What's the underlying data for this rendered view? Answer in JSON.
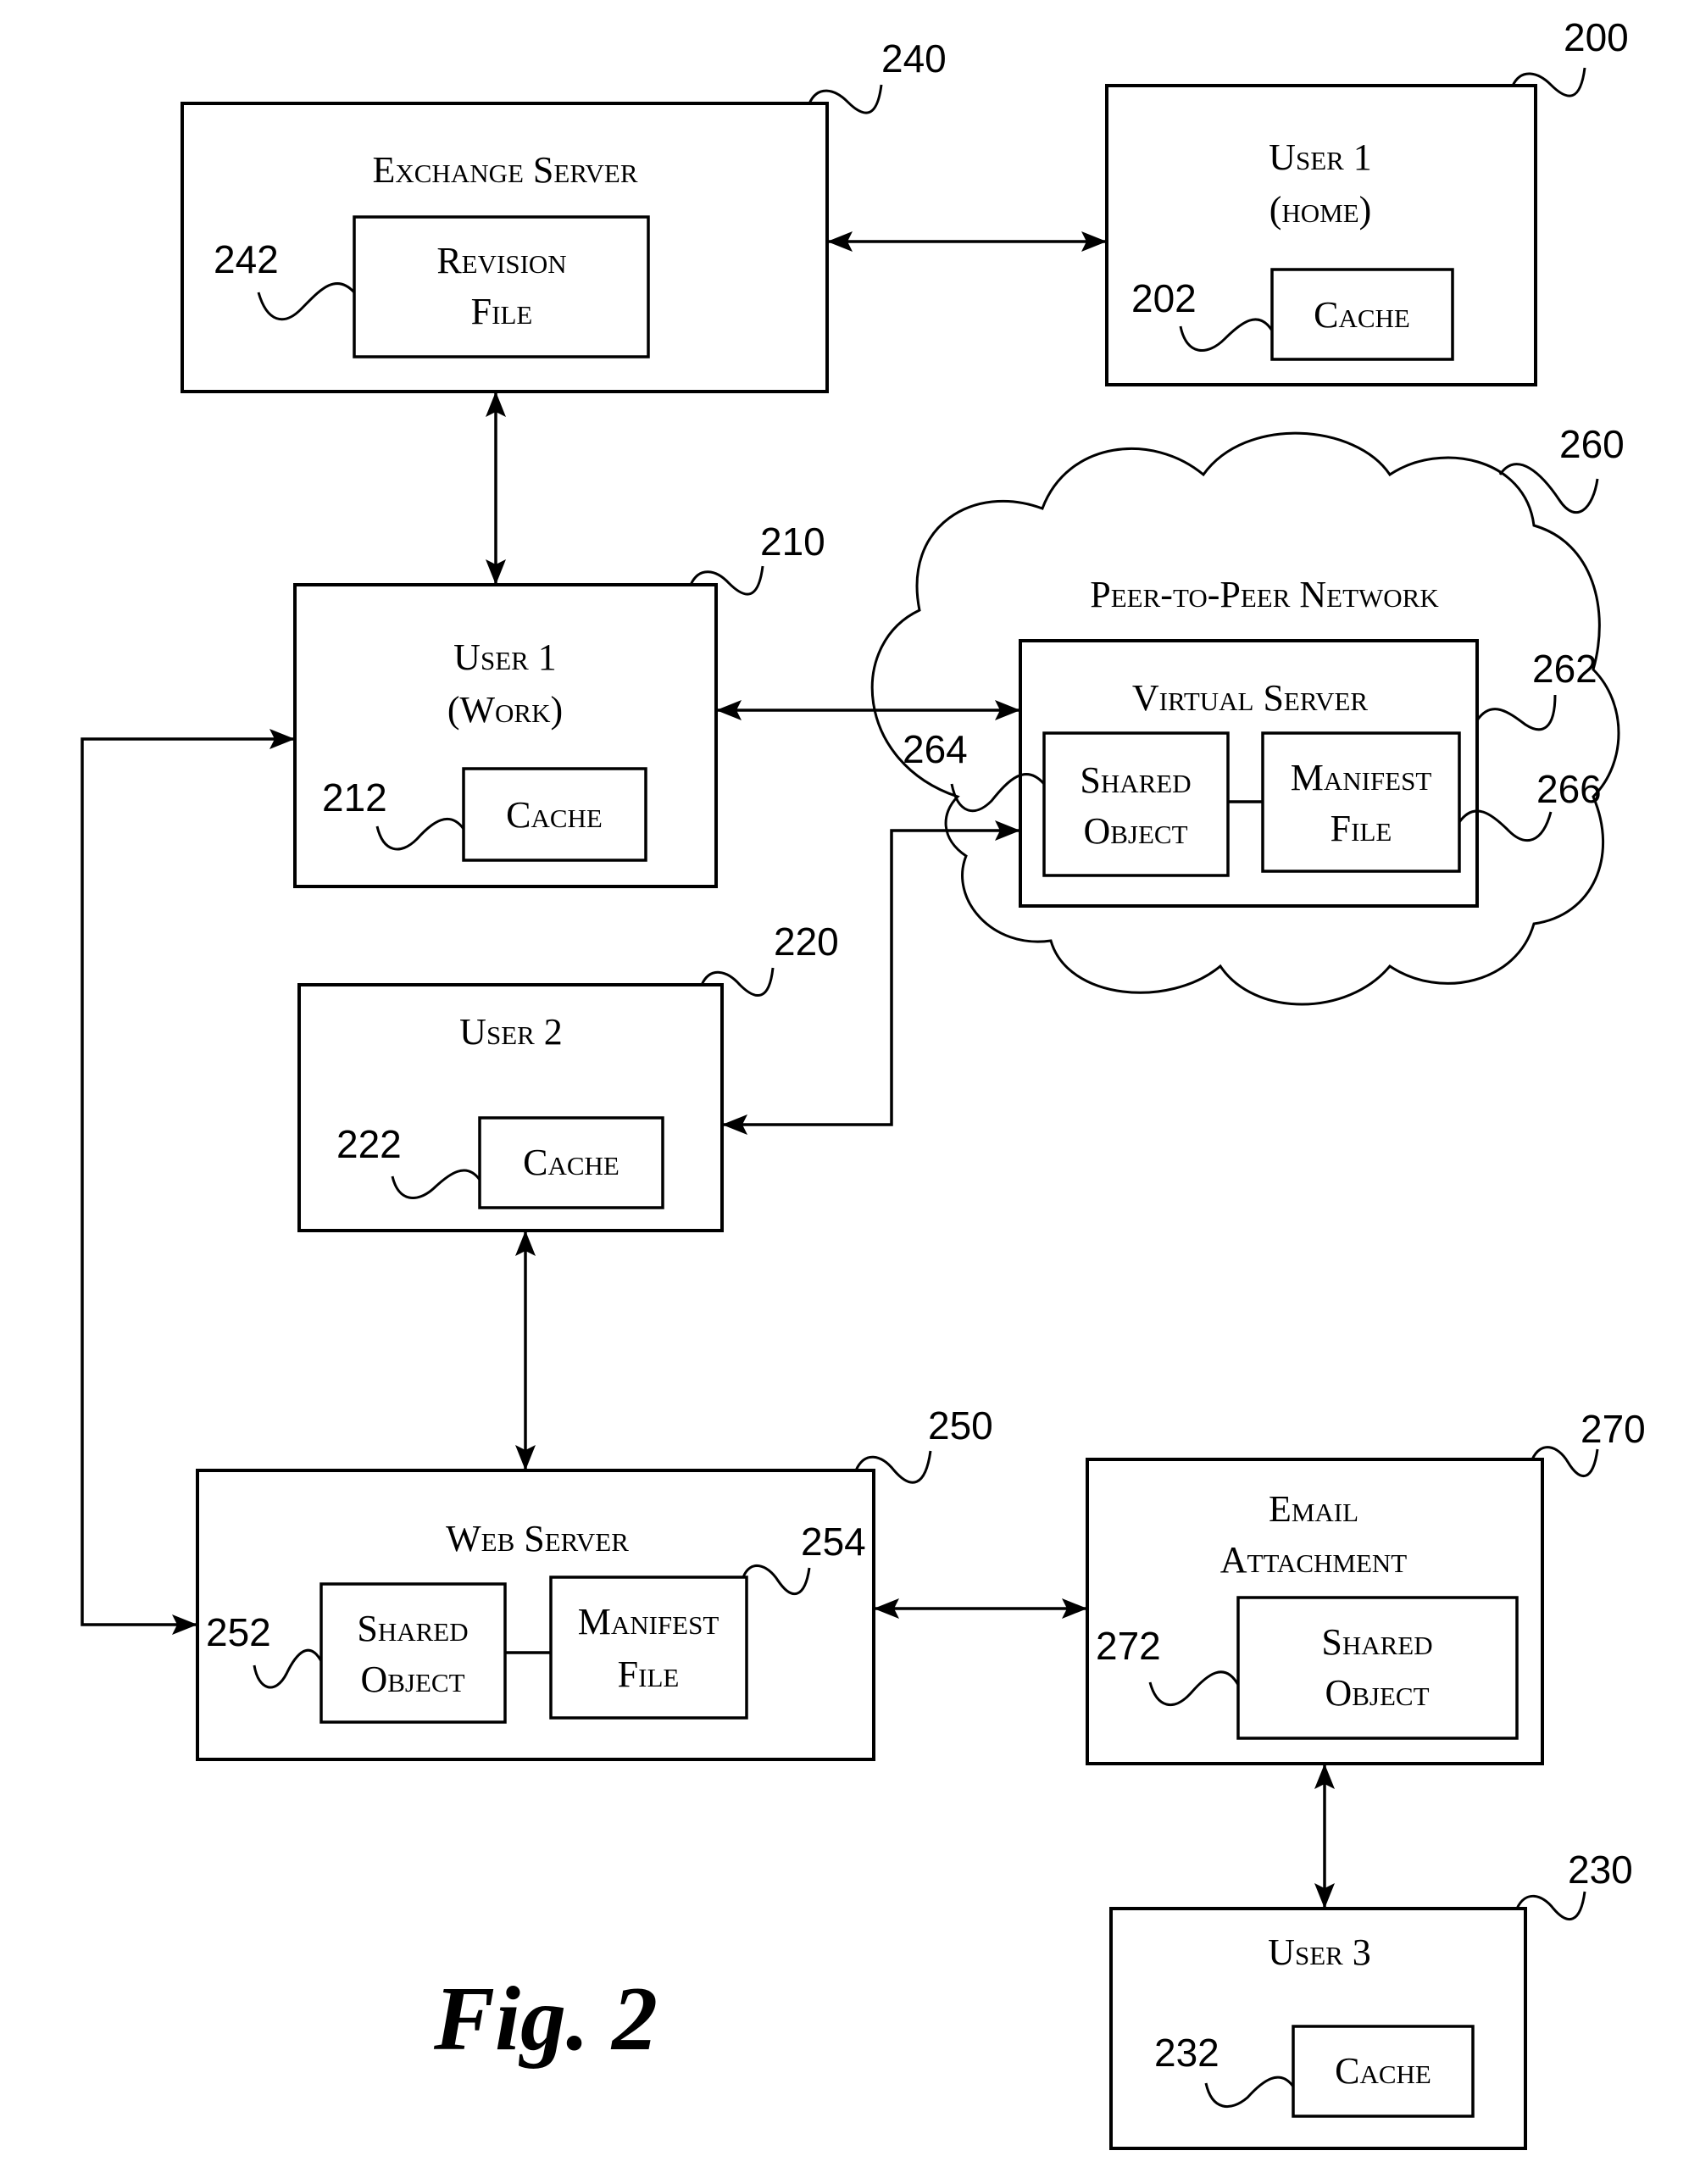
{
  "figure": {
    "caption": "Fig. 2",
    "system_ref": "200"
  },
  "nodes": {
    "exchange_server": {
      "ref": "240",
      "title": "Exchange Server",
      "revision_file": {
        "ref": "242",
        "line1": "Revision",
        "line2": "File"
      }
    },
    "user1_home": {
      "ref": "200",
      "line1": "User 1",
      "line2": "(home)",
      "cache": {
        "ref": "202",
        "label": "Cache"
      }
    },
    "user1_work": {
      "ref": "210",
      "line1": "User 1",
      "line2": "(Work)",
      "cache": {
        "ref": "212",
        "label": "Cache"
      }
    },
    "p2p_network": {
      "ref": "260",
      "title": "Peer-to-Peer Network",
      "virtual_server": {
        "ref": "262",
        "title": "Virtual Server",
        "shared_object": {
          "ref": "264",
          "line1": "Shared",
          "line2": "Object"
        },
        "manifest_file": {
          "ref": "266",
          "line1": "Manifest",
          "line2": "File"
        }
      }
    },
    "user2": {
      "ref": "220",
      "title": "User 2",
      "cache": {
        "ref": "222",
        "label": "Cache"
      }
    },
    "web_server": {
      "ref": "250",
      "title": "Web Server",
      "shared_object": {
        "ref": "252",
        "line1": "Shared",
        "line2": "Object"
      },
      "manifest_file": {
        "ref": "254",
        "line1": "Manifest",
        "line2": "File"
      }
    },
    "email_attachment": {
      "ref": "270",
      "line1": "Email",
      "line2": "Attachment",
      "shared_object": {
        "ref": "272",
        "line1": "Shared",
        "line2": "Object"
      }
    },
    "user3": {
      "ref": "230",
      "title": "User 3",
      "cache": {
        "ref": "232",
        "label": "Cache"
      }
    }
  },
  "connections": [
    {
      "from": "exchange_server",
      "to": "user1_home",
      "bidirectional": true
    },
    {
      "from": "exchange_server",
      "to": "user1_work",
      "bidirectional": true
    },
    {
      "from": "user1_work",
      "to": "virtual_server",
      "bidirectional": true
    },
    {
      "from": "user2",
      "to": "virtual_server",
      "bidirectional": true
    },
    {
      "from": "user1_work",
      "to": "web_server",
      "bidirectional": true
    },
    {
      "from": "user2",
      "to": "web_server",
      "bidirectional": true
    },
    {
      "from": "web_server",
      "to": "email_attachment",
      "bidirectional": true
    },
    {
      "from": "email_attachment",
      "to": "user3",
      "bidirectional": true
    }
  ]
}
